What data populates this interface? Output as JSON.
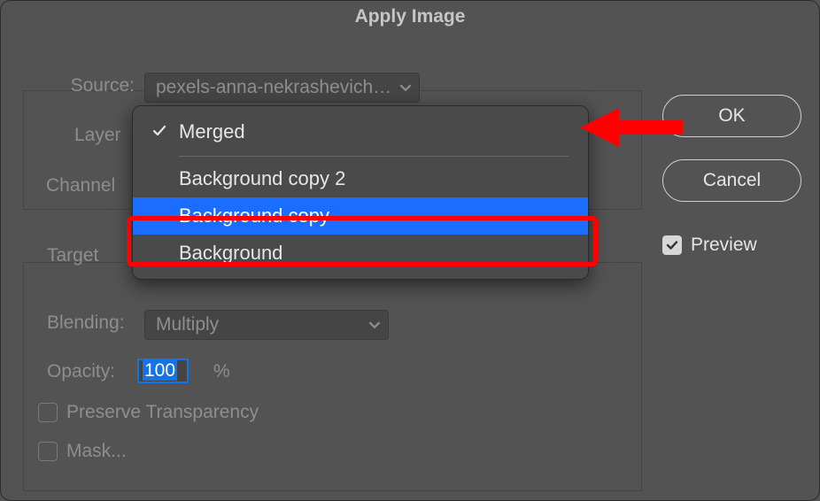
{
  "dialog": {
    "title": "Apply Image",
    "source": {
      "label": "Source:",
      "value": "pexels-anna-nekrashevich…"
    },
    "layer": {
      "label": "Layer",
      "options": [
        {
          "text": "Merged",
          "checked": true,
          "hovered": false
        },
        {
          "text": "Background copy 2",
          "checked": false,
          "hovered": false
        },
        {
          "text": "Background copy",
          "checked": false,
          "hovered": true
        },
        {
          "text": "Background",
          "checked": false,
          "hovered": false
        }
      ]
    },
    "channel": {
      "label": "Channel"
    },
    "target": {
      "label": "Target"
    },
    "blending": {
      "label": "Blending:",
      "value": "Multiply"
    },
    "opacity": {
      "label": "Opacity:",
      "value": "100",
      "suffix": "%"
    },
    "preserve": {
      "label": "Preserve Transparency",
      "checked": false
    },
    "mask": {
      "label": "Mask...",
      "checked": false
    }
  },
  "buttons": {
    "ok": "OK",
    "cancel": "Cancel"
  },
  "preview": {
    "label": "Preview",
    "checked": true
  },
  "colors": {
    "accent": "#1a6dff",
    "annotation": "#ff0000"
  }
}
